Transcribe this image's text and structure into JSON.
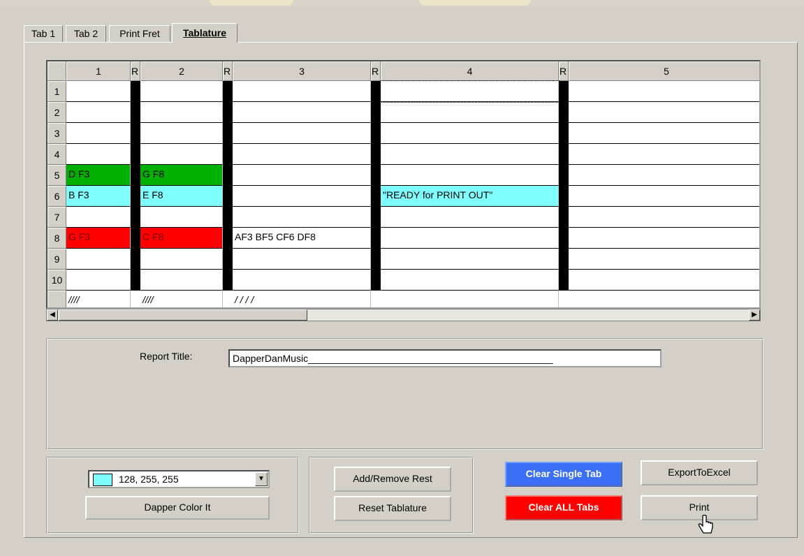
{
  "tabs": [
    "Tab 1",
    "Tab 2",
    "Print Fret",
    "Tablature"
  ],
  "grid": {
    "columns": [
      "1",
      "R",
      "2",
      "R",
      "3",
      "R",
      "4",
      "R",
      "5"
    ],
    "row_numbers": [
      "1",
      "2",
      "3",
      "4",
      "5",
      "6",
      "7",
      "8",
      "9",
      "10"
    ],
    "cells": {
      "r5c1": "D F3",
      "r5c2": "G F8",
      "r6c1": "B F3",
      "r6c2": "E F8",
      "r6c4": "\"READY for PRINT OUT\"",
      "r8c1": "G F3",
      "r8c2": "C F8",
      "r8c3": "AF3  BF5  CF6  DF8"
    },
    "footer": {
      "c1": "////",
      "c2": "////",
      "c3": "/       /       /       /"
    }
  },
  "colors": {
    "green": "#00b000",
    "cyan": "#80ffff",
    "red": "#ff0000",
    "blue_button": "#3b6ff5"
  },
  "report": {
    "label": "Report Title:",
    "value": "DapperDanMusic_____________________________________________"
  },
  "color_picker": {
    "value": "128, 255, 255",
    "swatch": "#80ffff"
  },
  "buttons": {
    "dapper_color_it": "Dapper Color It",
    "add_remove_rest": "Add/Remove Rest",
    "reset_tablature": "Reset Tablature",
    "clear_single_tab": "Clear Single Tab",
    "clear_all_tabs": "Clear ALL Tabs",
    "export_to_excel": "ExportToExcel",
    "print": "Print"
  }
}
